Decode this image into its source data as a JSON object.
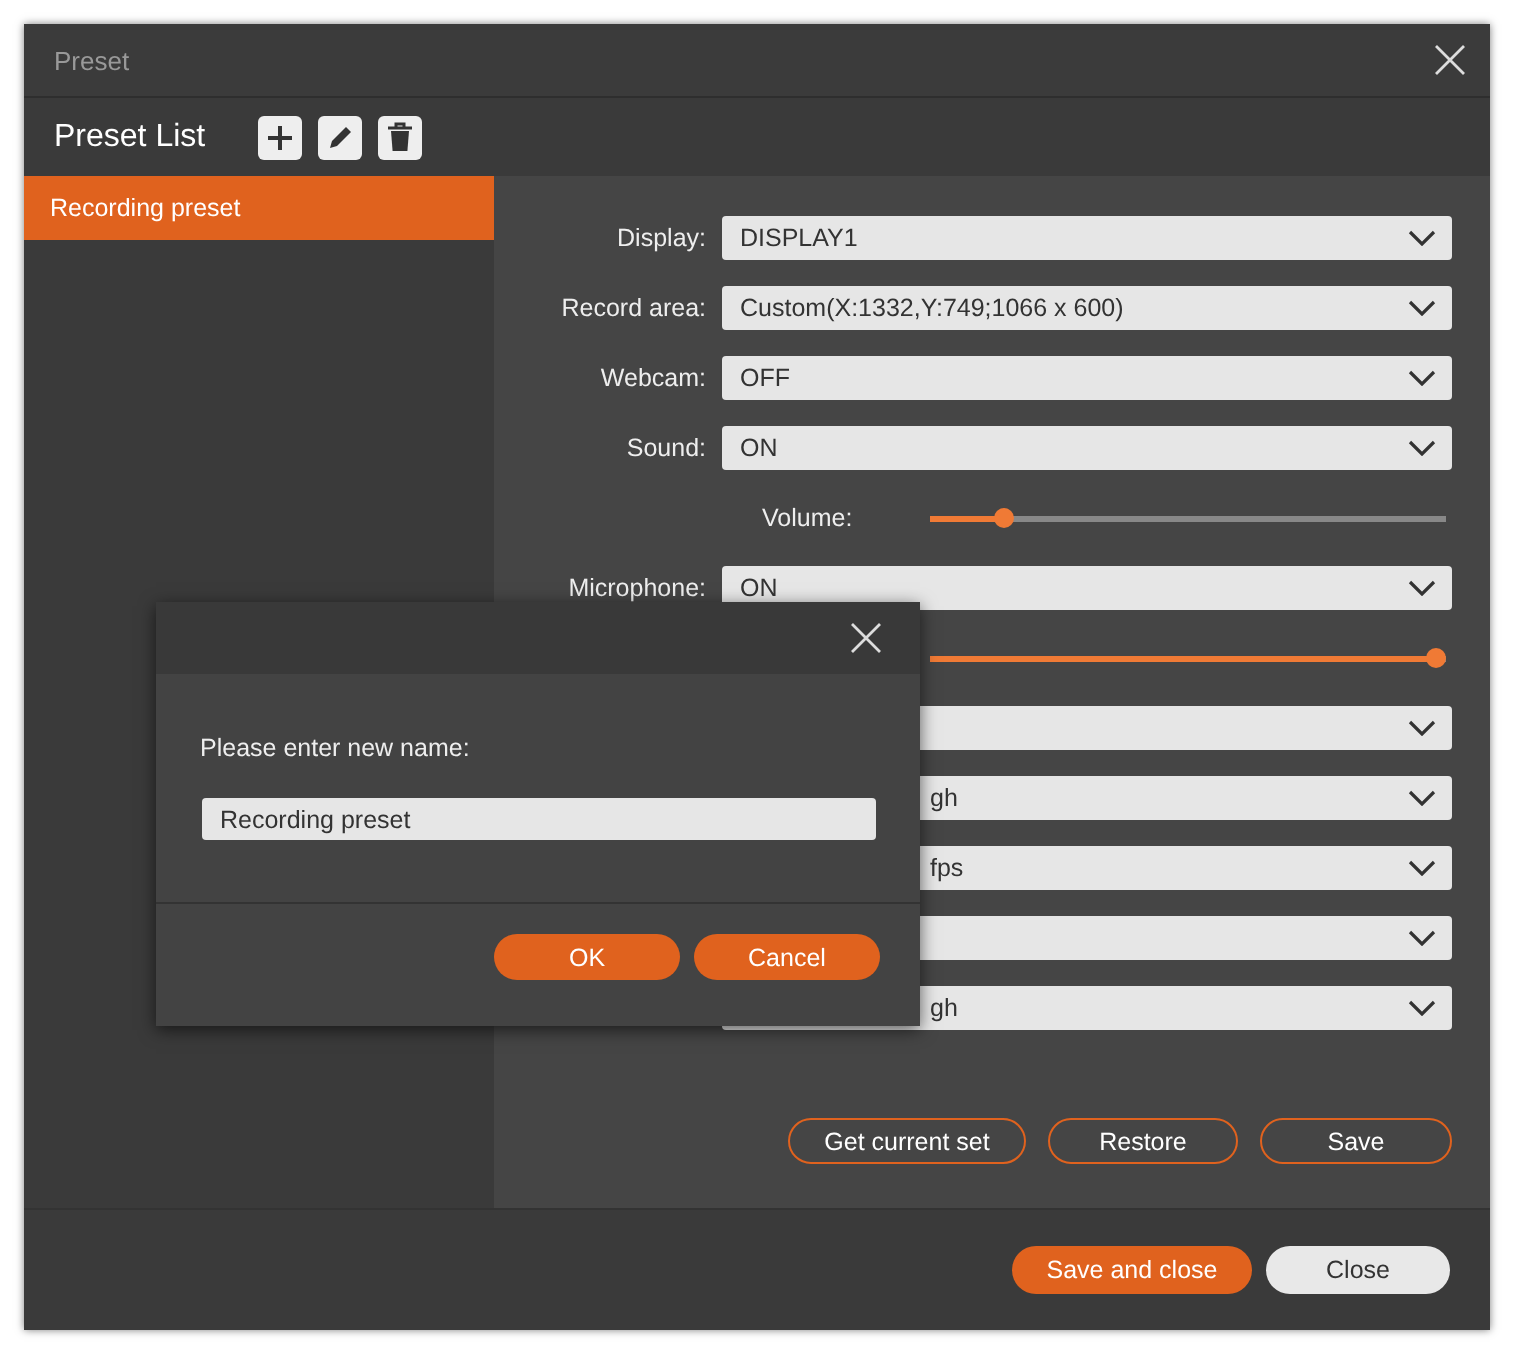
{
  "window": {
    "title": "Preset"
  },
  "preset_list": {
    "title": "Preset List",
    "items": [
      {
        "label": "Recording preset",
        "selected": true
      }
    ]
  },
  "settings": [
    {
      "kind": "dropdown",
      "label": "Display:",
      "value": "DISPLAY1"
    },
    {
      "kind": "dropdown",
      "label": "Record area:",
      "value": "Custom(X:1332,Y:749;1066 x 600)"
    },
    {
      "kind": "dropdown",
      "label": "Webcam:",
      "value": "OFF"
    },
    {
      "kind": "dropdown",
      "label": "Sound:",
      "value": "ON"
    },
    {
      "kind": "slider",
      "label": "Volume:",
      "level": 0.13
    },
    {
      "kind": "dropdown",
      "label": "Microphone:",
      "value": "ON"
    },
    {
      "kind": "covered_slider",
      "level": 1.0
    },
    {
      "kind": "covered_dropdown"
    },
    {
      "kind": "covered_dropdown",
      "value": "gh"
    },
    {
      "kind": "covered_dropdown",
      "value": "fps"
    },
    {
      "kind": "covered_dropdown"
    },
    {
      "kind": "covered_dropdown",
      "value": "gh"
    }
  ],
  "panel_buttons": [
    "Get current set",
    "Restore",
    "Save"
  ],
  "footer_buttons": [
    {
      "label": "Save and close",
      "kind": "primary"
    },
    {
      "label": "Close",
      "kind": "secondary"
    }
  ],
  "dialog": {
    "prompt": "Please enter new name:",
    "value": "Recording preset",
    "buttons": [
      "OK",
      "Cancel"
    ]
  }
}
